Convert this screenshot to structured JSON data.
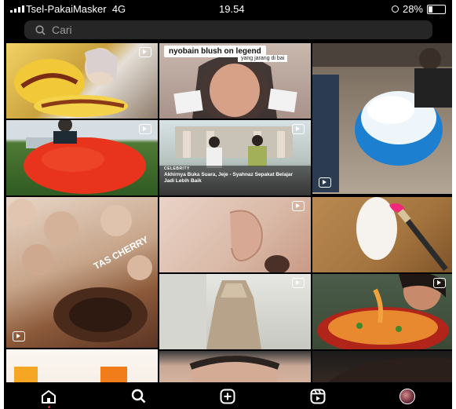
{
  "status_bar": {
    "carrier": "Tsel-PakaiMasker",
    "network": "4G",
    "time": "19.54",
    "battery": "28%",
    "battery_level": 0.28
  },
  "search": {
    "placeholder": "Cari",
    "icon": "search-icon"
  },
  "tiles": {
    "blush": {
      "caption": "nyobain blush on legend",
      "subcaption": "yang jarang di bai"
    },
    "celebrity": {
      "tag": "CELEBRITY",
      "headline": "Akhirnya Buka Suara, Jeje - Syahnaz Sepakat Belajar Jadi Lebih Baik"
    },
    "cherry": {
      "text": "TAS CHERRY"
    }
  },
  "nav": {
    "items": [
      {
        "name": "home",
        "icon": "home-icon",
        "active": true
      },
      {
        "name": "search",
        "icon": "search-icon"
      },
      {
        "name": "create",
        "icon": "plus-square-icon"
      },
      {
        "name": "reels",
        "icon": "reels-icon"
      },
      {
        "name": "profile",
        "icon": "avatar-icon"
      }
    ],
    "active_dot_color": "#e3294a"
  },
  "colors": {
    "background": "#000000",
    "search_bg": "#262626",
    "placeholder": "#9a9a9a"
  }
}
